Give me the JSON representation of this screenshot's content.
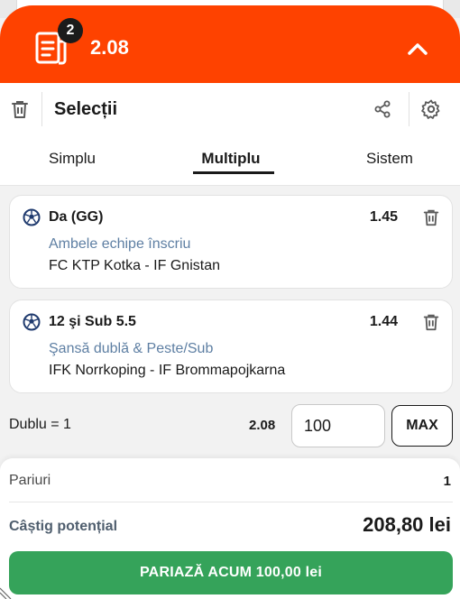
{
  "header": {
    "badge_count": "2",
    "total_odds": "2.08",
    "bg_color": "#fe4200"
  },
  "toolbar": {
    "title": "Selecții",
    "icons": [
      "trash-icon",
      "share-icon",
      "gear-icon"
    ]
  },
  "tabs": [
    {
      "label": "Simplu",
      "active": false
    },
    {
      "label": "Multiplu",
      "active": true
    },
    {
      "label": "Sistem",
      "active": false
    }
  ],
  "selections": [
    {
      "pick": "Da (GG)",
      "odds": "1.45",
      "market": "Ambele echipe înscriu",
      "match": "FC KTP Kotka - IF Gnistan"
    },
    {
      "pick": "12 şi Sub 5.5",
      "odds": "1.44",
      "market": "Şansă dublă & Peste/Sub",
      "match": "IFK Norrkoping - IF Brommapojkarna"
    }
  ],
  "stake": {
    "label": "Dublu = 1",
    "odds": "2.08",
    "value": "100",
    "max_label": "MAX"
  },
  "summary": {
    "bets_label": "Pariuri",
    "bets_value": "1",
    "win_label": "Câștig potențial",
    "win_value": "208,80 lei",
    "place_label": "PARIAZĂ ACUM 100,00 lei",
    "button_color": "#35a35a"
  }
}
